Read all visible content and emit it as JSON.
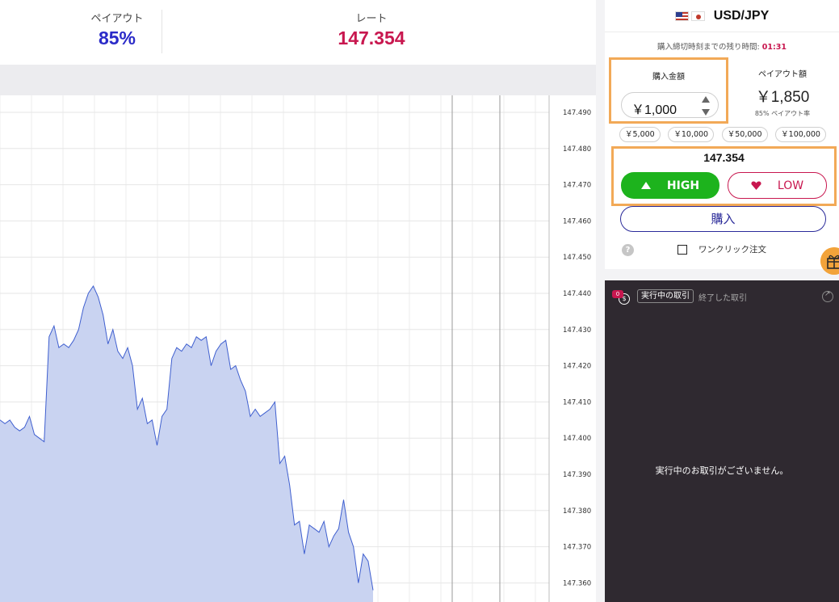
{
  "header": {
    "payout_label": "ペイアウト",
    "payout_value": "85%",
    "rate_label": "レート",
    "rate_value": "147.354"
  },
  "chart_data": {
    "type": "area",
    "y_ticks": [
      "147.490",
      "147.480",
      "147.470",
      "147.460",
      "147.450",
      "147.440",
      "147.430",
      "147.420",
      "147.410",
      "147.400",
      "147.390",
      "147.380",
      "147.370",
      "147.360"
    ],
    "ylim": [
      147.355,
      147.493
    ],
    "series": [
      {
        "values": [
          147.405,
          147.404,
          147.405,
          147.403,
          147.402,
          147.403,
          147.406,
          147.401,
          147.4,
          147.399,
          147.428,
          147.431,
          147.425,
          147.426,
          147.425,
          147.427,
          147.43,
          147.436,
          147.44,
          147.442,
          147.439,
          147.434,
          147.426,
          147.43,
          147.424,
          147.422,
          147.425,
          147.42,
          147.408,
          147.411,
          147.404,
          147.405,
          147.398,
          147.406,
          147.408,
          147.422,
          147.425,
          147.424,
          147.426,
          147.425,
          147.428,
          147.427,
          147.428,
          147.42,
          147.424,
          147.426,
          147.427,
          147.419,
          147.42,
          147.416,
          147.413,
          147.406,
          147.408,
          147.406,
          147.407,
          147.408,
          147.41,
          147.393,
          147.395,
          147.387,
          147.376,
          147.377,
          147.368,
          147.376,
          147.375,
          147.374,
          147.377,
          147.37,
          147.373,
          147.375,
          147.383,
          147.374,
          147.37,
          147.36,
          147.368,
          147.366,
          147.358
        ]
      }
    ]
  },
  "asset": {
    "name": "USD/JPY",
    "flag_left": "us-flag",
    "flag_right": "jp-flag"
  },
  "countdown": {
    "label": "購入締切時刻までの残り時間:",
    "time": "01:31"
  },
  "amount": {
    "label": "購入金額",
    "value": "￥1,000"
  },
  "payout_amount": {
    "label": "ペイアウト額",
    "value": "￥1,850",
    "rate_note": "85% ペイアウト率"
  },
  "presets": [
    "￥5,000",
    "￥10,000",
    "￥50,000",
    "￥100,000"
  ],
  "trade": {
    "price": "147.354",
    "high_label": "HIGH",
    "low_label": "LOW",
    "high_color": "#1db31d",
    "low_color": "#c8174f"
  },
  "buy": {
    "label": "購入"
  },
  "help": {
    "glyph": "?"
  },
  "oneclick": {
    "label": "ワンクリック注文"
  },
  "trades_panel": {
    "badge": "0",
    "coin_glyph": "$",
    "tab_active": "実行中の取引",
    "tab_inactive": "終了した取引",
    "empty_message": "実行中のお取引がございません。"
  }
}
